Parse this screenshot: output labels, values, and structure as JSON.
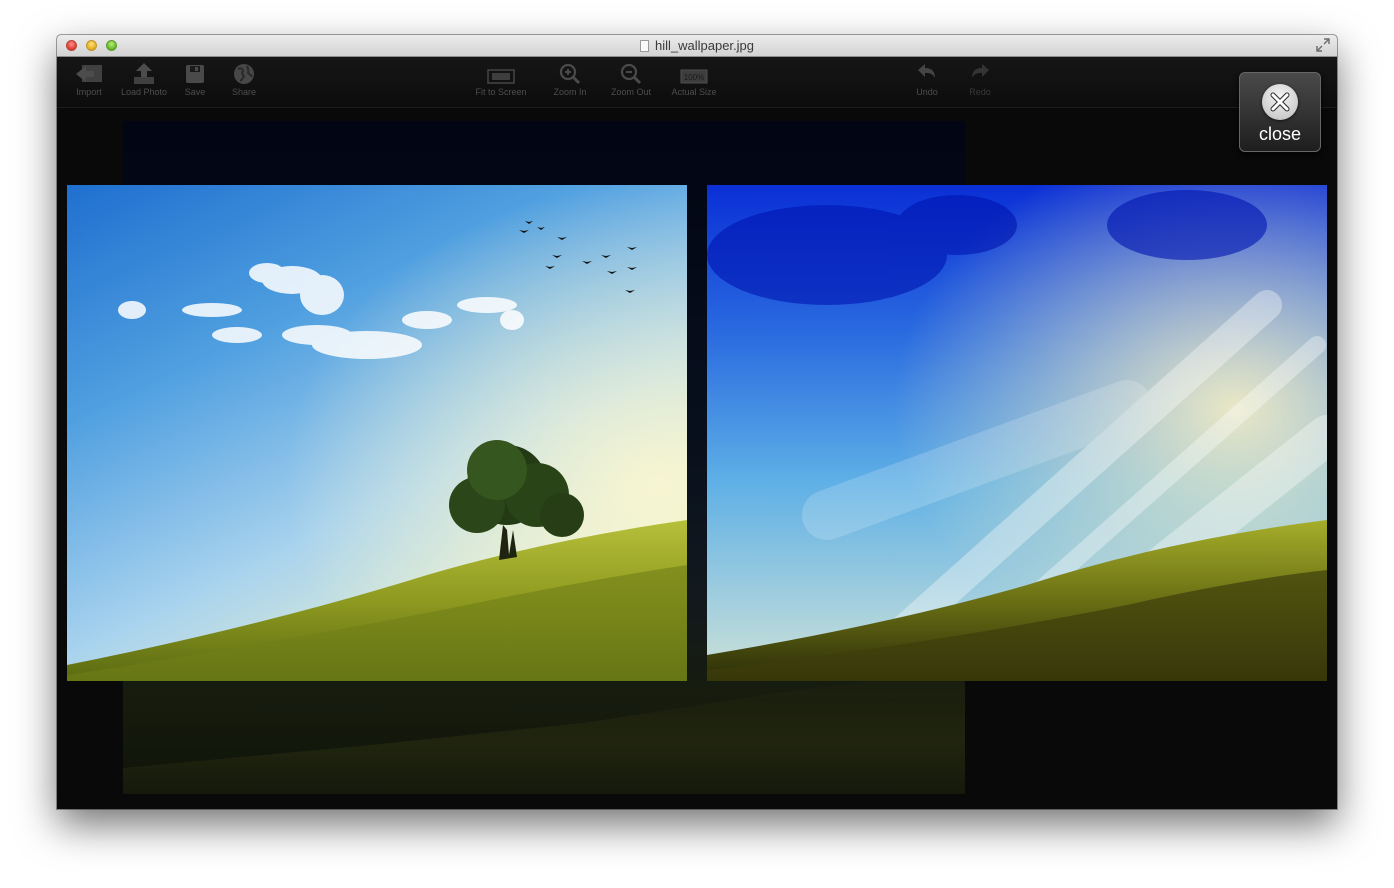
{
  "window": {
    "title": "hill_wallpaper.jpg"
  },
  "toolbar": {
    "import_label": "Import",
    "load_photo_label": "Load Photo",
    "save_label": "Save",
    "share_label": "Share",
    "fit_to_screen_label": "Fit to Screen",
    "zoom_in_label": "Zoom In",
    "zoom_out_label": "Zoom Out",
    "actual_size_label": "Actual Size",
    "actual_size_badge": "100%",
    "undo_label": "Undo",
    "redo_label": "Redo"
  },
  "close_button": {
    "label": "close"
  },
  "icons": {
    "import": "import-icon",
    "load_photo": "upload-icon",
    "save": "floppy-disk-icon",
    "share": "globe-icon",
    "fit_to_screen": "fit-screen-icon",
    "zoom_in": "magnifier-plus-icon",
    "zoom_out": "magnifier-minus-icon",
    "actual_size": "actual-size-icon",
    "undo": "undo-arrow-icon",
    "redo": "redo-arrow-icon",
    "close": "close-x-icon"
  }
}
